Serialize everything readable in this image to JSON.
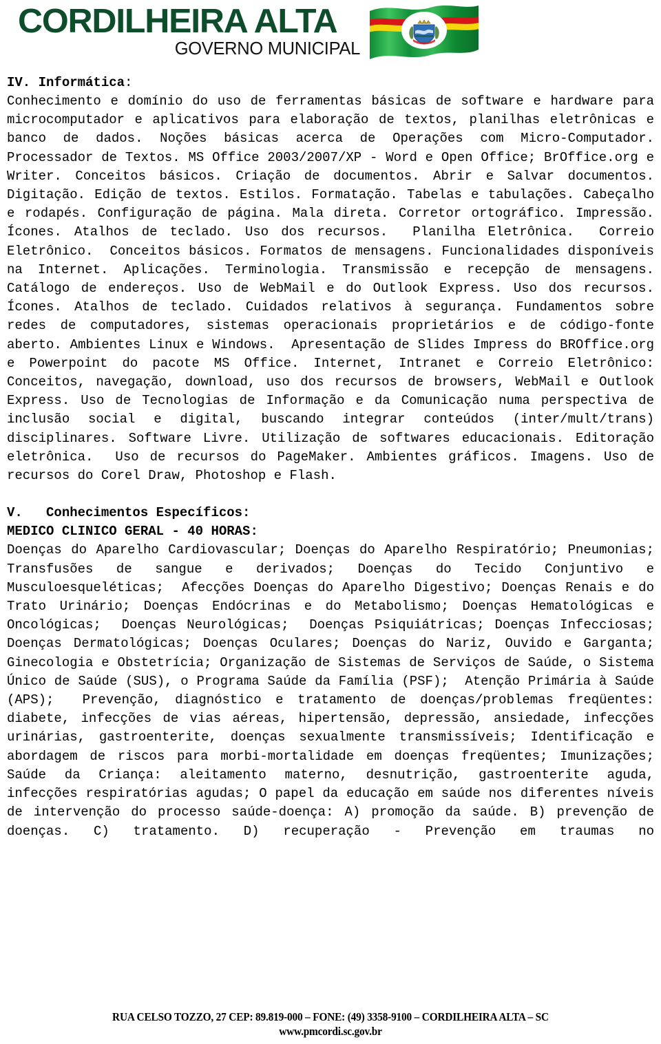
{
  "header": {
    "logo_main": "CORDILHEIRA ALTA",
    "logo_sub": "GOVERNO MUNICIPAL",
    "logo_color": "#0e4d2c",
    "flag": {
      "name": "cordilheira-alta-flag",
      "field_color": "#1e9e3e",
      "stripe_red": "#d8161a",
      "stripe_yellow": "#f5d60b",
      "emblem_bg": "#ffffff",
      "shield_color": "#2f6fb5"
    }
  },
  "sections": [
    {
      "id": "section-iv",
      "heading_bold": "IV. Informática",
      "heading_tail": ":",
      "body": "Conhecimento e domínio do uso de ferramentas básicas de software e hardware para microcomputador e aplicativos para elaboração de textos, planilhas eletrônicas e banco de dados. Noções básicas acerca de Operações com Micro-Computador. Processador de Textos. MS Office 2003/2007/XP - Word e Open Office; BrOffice.org e Writer. Conceitos básicos. Criação de documentos. Abrir e Salvar documentos. Digitação. Edição de textos. Estilos. Formatação. Tabelas e tabulações. Cabeçalho e rodapés. Configuração de página. Mala direta. Corretor ortográfico. Impressão. Ícones. Atalhos de teclado. Uso dos recursos.  Planilha Eletrônica.  Correio Eletrônico.  Conceitos básicos. Formatos de mensagens. Funcionalidades disponíveis na Internet. Aplicações. Terminologia. Transmissão e recepção de mensagens. Catálogo de endereços. Uso de WebMail e do Outlook Express. Uso dos recursos. Ícones. Atalhos de teclado. Cuidados relativos à segurança. Fundamentos sobre redes de computadores, sistemas operacionais proprietários e de código-fonte aberto. Ambientes Linux e Windows.  Apresentação de Slides Impress do BROffice.org e Powerpoint do pacote MS Office. Internet, Intranet e Correio Eletrônico: Conceitos, navegação, download, uso dos recursos de browsers, WebMail e Outlook Express. Uso de Tecnologias de Informação e da Comunicação numa perspectiva de inclusão social e digital, buscando integrar conteúdos (inter/mult/trans) disciplinares. Software Livre. Utilização de softwares educacionais. Editoração eletrônica.  Uso de recursos do PageMaker. Ambientes gráficos. Imagens. Uso de recursos do Corel Draw, Photoshop e Flash."
    },
    {
      "id": "section-v",
      "heading_bold": "V.   Conhecimentos Específicos:",
      "subheading": "MEDICO CLINICO GERAL - 40 HORAS:",
      "body": "Doenças do Aparelho Cardiovascular; Doenças do Aparelho Respiratório; Pneumonias;  Transfusões de sangue e derivados; Doenças do Tecido Conjuntivo e Musculoesqueléticas;  Afecções Doenças do Aparelho Digestivo; Doenças Renais e do Trato Urinário; Doenças Endócrinas e do Metabolismo; Doenças Hematológicas e Oncológicas;  Doenças Neurológicas;  Doenças Psiquiátricas; Doenças Infecciosas; Doenças Dermatológicas; Doenças Oculares; Doenças do Nariz, Ouvido e Garganta;  Ginecologia e Obstetrícia; Organização de Sistemas de Serviços de Saúde, o Sistema Único de Saúde (SUS), o Programa Saúde da Família (PSF);  Atenção Primária à Saúde (APS);  Prevenção, diagnóstico e tratamento de doenças/problemas freqüentes: diabete, infecções de vias aéreas, hipertensão, depressão, ansiedade, infecções urinárias, gastroenterite, doenças sexualmente transmissíveis; Identificação e abordagem de riscos para morbi-mortalidade em doenças freqüentes; Imunizações; Saúde da Criança: aleitamento materno, desnutrição, gastroenterite aguda, infecções respiratórias agudas; O papel da educação em saúde nos diferentes níveis de intervenção do processo saúde-doença: A) promoção da saúde. B) prevenção de doenças. C) tratamento. D) recuperação - Prevenção em traumas no"
    }
  ],
  "footer": {
    "address_line": "RUA CELSO TOZZO, 27 CEP: 89.819-000 – FONE: (49) 3358-9100 – CORDILHEIRA ALTA – SC",
    "website": "www.pmcordi.sc.gov.br"
  }
}
